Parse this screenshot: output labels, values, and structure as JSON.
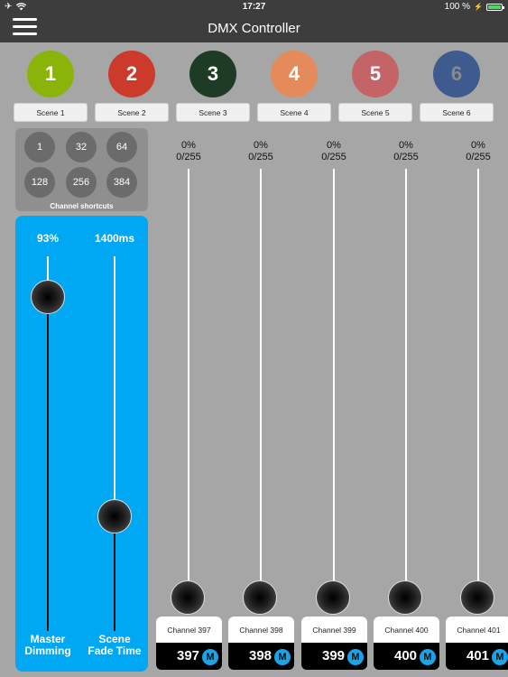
{
  "status_bar": {
    "time": "17:27",
    "battery": "100 %"
  },
  "nav": {
    "title": "DMX Controller"
  },
  "scenes": [
    {
      "number": "1",
      "label": "Scene 1",
      "color": "#8ab40a",
      "text_color": "#ffffff"
    },
    {
      "number": "2",
      "label": "Scene 2",
      "color": "#cc3a2c",
      "text_color": "#ffffff"
    },
    {
      "number": "3",
      "label": "Scene 3",
      "color": "#1e3b26",
      "text_color": "#ffffff"
    },
    {
      "number": "4",
      "label": "Scene 4",
      "color": "#e58a5a",
      "text_color": "#ffffff"
    },
    {
      "number": "5",
      "label": "Scene 5",
      "color": "#c46467",
      "text_color": "#ffffff"
    },
    {
      "number": "6",
      "label": "Scene 6",
      "color": "#3f5a8f",
      "text_color": "#8a8a8a"
    }
  ],
  "shortcuts": {
    "items": [
      "1",
      "32",
      "64",
      "128",
      "256",
      "384"
    ],
    "label": "Channel shortcuts"
  },
  "master": {
    "dimming_value": "93%",
    "dimming_label_1": "Master",
    "dimming_label_2": "Dimming",
    "dimming_level": 0.93,
    "fade_value": "1400ms",
    "fade_label_1": "Scene",
    "fade_label_2": "Fade Time",
    "fade_level": 0.3,
    "panel_color": "#00a8f4"
  },
  "channels": [
    {
      "percent": "0%",
      "value": "0/255",
      "name": "Channel 397",
      "number": "397",
      "badge": "M"
    },
    {
      "percent": "0%",
      "value": "0/255",
      "name": "Channel 398",
      "number": "398",
      "badge": "M"
    },
    {
      "percent": "0%",
      "value": "0/255",
      "name": "Channel 399",
      "number": "399",
      "badge": "M"
    },
    {
      "percent": "0%",
      "value": "0/255",
      "name": "Channel 400",
      "number": "400",
      "badge": "M"
    },
    {
      "percent": "0%",
      "value": "0/255",
      "name": "Channel 401",
      "number": "401",
      "badge": "M"
    }
  ]
}
